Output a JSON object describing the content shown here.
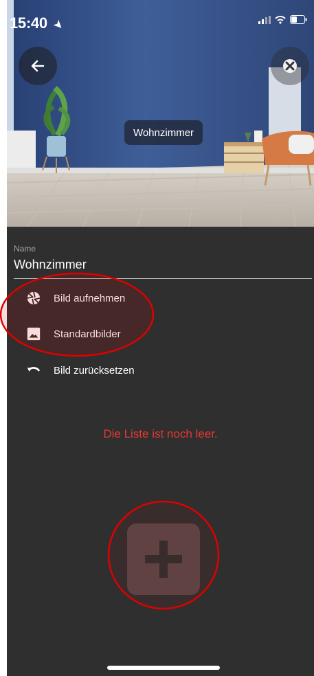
{
  "status_bar": {
    "time": "15:40",
    "location_icon": "location-arrow-icon",
    "signal_icon": "cellular-signal-icon",
    "wifi_icon": "wifi-icon",
    "battery_icon": "battery-icon"
  },
  "header": {
    "back_icon": "arrow-left-icon",
    "close_icon": "close-icon",
    "room_label": "Wohnzimmer"
  },
  "form": {
    "name_label": "Name",
    "name_value": "Wohnzimmer"
  },
  "menu": {
    "items": [
      {
        "label": "Bild aufnehmen",
        "icon": "camera-shutter-icon"
      },
      {
        "label": "Standardbilder",
        "icon": "image-icon"
      },
      {
        "label": "Bild zurücksetzen",
        "icon": "undo-icon"
      }
    ]
  },
  "list": {
    "empty_message": "Die Liste ist noch leer."
  },
  "actions": {
    "add_icon": "plus-icon"
  },
  "colors": {
    "background": "#2f2f2f",
    "error_text": "#e53935",
    "add_button": "#5a4747",
    "annotation": "#e00000"
  }
}
